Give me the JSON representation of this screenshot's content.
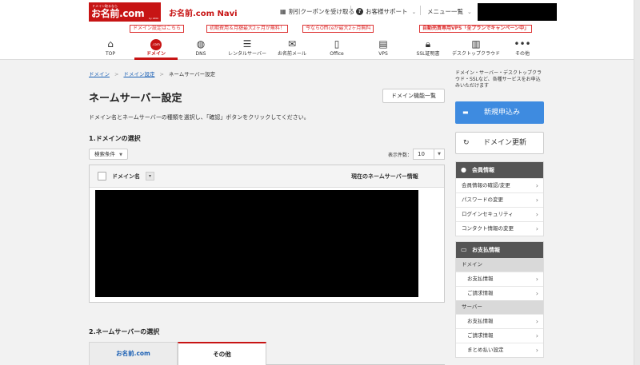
{
  "header": {
    "logo_small": "ドメイン取るなら",
    "logo_main": "お名前.com",
    "logo_sub": "by GMO",
    "navi_title": "お名前.com Navi",
    "coupon_link": "割引クーポンを受け取る",
    "support_link": "お客様サポート",
    "menu_link": "メニュー一覧"
  },
  "promos": [
    "ドメイン設定はこちら",
    "初期費用＆月額最大2ヶ月が無料！",
    "今ならOfficeが最大2ヶ月無料",
    "自動売買専用VPS「全プランでキャンペーン中」"
  ],
  "gnav": [
    {
      "label": "TOP",
      "icon": "home-icon"
    },
    {
      "label": "ドメイン",
      "icon": "dotcom-icon"
    },
    {
      "label": "DNS",
      "icon": "globe-icon"
    },
    {
      "label": "レンタルサーバー",
      "icon": "server-icon"
    },
    {
      "label": "お名前メール",
      "icon": "mail-icon"
    },
    {
      "label": "Office",
      "icon": "office-icon"
    },
    {
      "label": "VPS",
      "icon": "vps-icon"
    },
    {
      "label": "SSL証明書",
      "icon": "lock-icon"
    },
    {
      "label": "デスクトップクラウド",
      "icon": "chart-icon"
    },
    {
      "label": "その他",
      "icon": "more-icon"
    }
  ],
  "breadcrumb": {
    "items": [
      "ドメイン",
      "ドメイン設定"
    ],
    "current": "ネームサーバー設定"
  },
  "main": {
    "title": "ネームサーバー設定",
    "feature_button": "ドメイン機能一覧",
    "description": "ドメイン名とネームサーバーの種類を選択し、「確認」ボタンをクリックしてください。",
    "section1_title": "1.ドメインの選択",
    "filter_button": "検索条件",
    "per_page_label": "表示件数：",
    "per_page_value": "10",
    "col_domain": "ドメイン名",
    "col_ns": "現在のネームサーバー情報",
    "section2_title": "2.ネームサーバーの選択",
    "tab_onamae": "お名前.com",
    "tab_other": "その他"
  },
  "sidebar": {
    "note": "ドメイン・サーバー・デスクトップクラウド・SSLなど、各種サービスをお申込みいただけます",
    "new_button": "新規申込み",
    "renew_button": "ドメイン更新",
    "member_title": "会員情報",
    "member_links": [
      "会員情報の確認/変更",
      "パスワードの変更",
      "ログインセキュリティ",
      "コンタクト情報の変更"
    ],
    "payment_title": "お支払情報",
    "payment_domain": "ドメイン",
    "payment_domain_links": [
      "お支払情報",
      "ご請求情報"
    ],
    "payment_server": "サーバー",
    "payment_server_links": [
      "お支払情報",
      "ご請求情報",
      "まとめ払い設定"
    ]
  },
  "colors": {
    "brand": "#c71414",
    "primary_button": "#3e8be0",
    "link": "#1a5fb4"
  }
}
